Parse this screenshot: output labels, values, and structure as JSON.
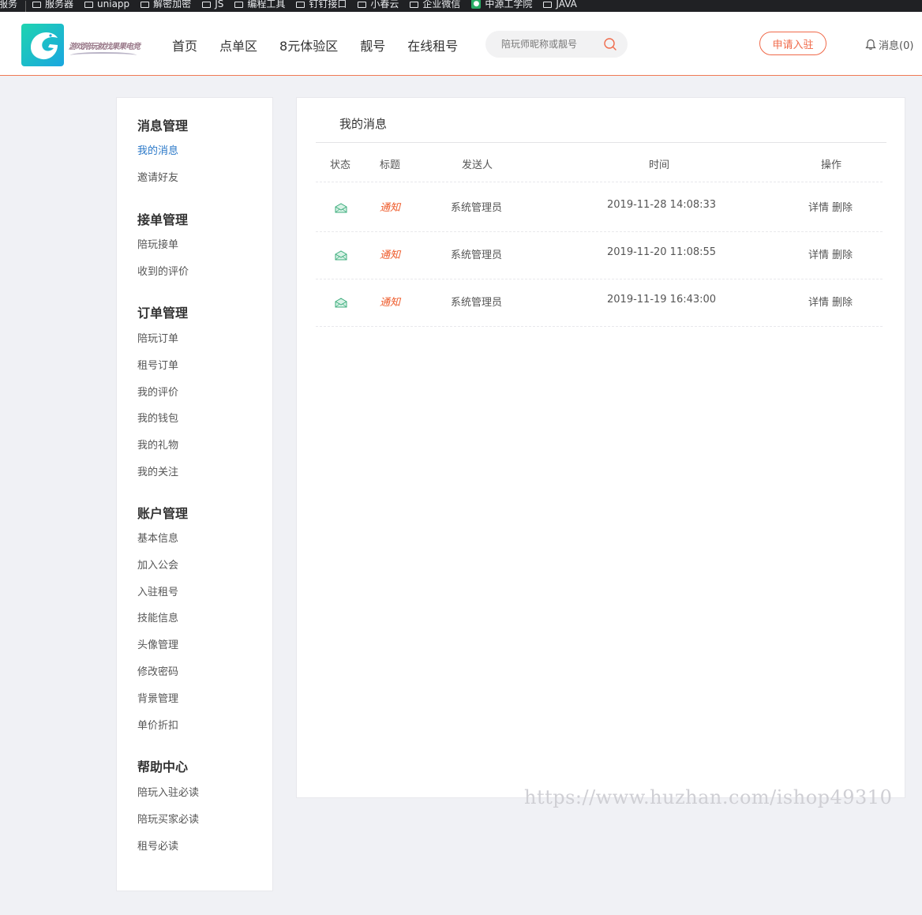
{
  "bookmarks": [
    {
      "label": "服务",
      "icon": "none"
    },
    {
      "label": "服务器",
      "icon": "folder-icon"
    },
    {
      "label": "uniapp",
      "icon": "folder-icon"
    },
    {
      "label": "解密加密",
      "icon": "folder-icon"
    },
    {
      "label": "JS",
      "icon": "folder-icon"
    },
    {
      "label": "编程工具",
      "icon": "folder-icon"
    },
    {
      "label": "钉钉接口",
      "icon": "folder-icon"
    },
    {
      "label": "小春云",
      "icon": "folder-icon"
    },
    {
      "label": "企业微信",
      "icon": "folder-icon"
    },
    {
      "label": "中源工学院",
      "icon": "green-app-icon"
    },
    {
      "label": "JAVA",
      "icon": "folder-icon"
    }
  ],
  "header": {
    "logo_text": "游戏陪玩就找果果电竞",
    "nav": [
      "首页",
      "点单区",
      "8元体验区",
      "靓号",
      "在线租号"
    ],
    "search_placeholder": "陪玩师昵称或靓号",
    "apply_label": "申请入驻",
    "messages_label": "消息(0)",
    "accent_color": "#f06a4a"
  },
  "sidebar": {
    "groups": [
      {
        "title": "消息管理",
        "items": [
          "我的消息",
          "邀请好友"
        ]
      },
      {
        "title": "接单管理",
        "items": [
          "陪玩接单",
          "收到的评价"
        ]
      },
      {
        "title": "订单管理",
        "items": [
          "陪玩订单",
          "租号订单",
          "我的评价",
          "我的钱包",
          "我的礼物",
          "我的关注"
        ]
      },
      {
        "title": "账户管理",
        "items": [
          "基本信息",
          "加入公会",
          "入驻租号",
          "技能信息",
          "头像管理",
          "修改密码",
          "背景管理",
          "单价折扣"
        ]
      },
      {
        "title": "帮助中心",
        "items": [
          "陪玩入驻必读",
          "陪玩买家必读",
          "租号必读"
        ]
      }
    ],
    "active_item": "我的消息",
    "active_color": "#2a78c8"
  },
  "main": {
    "title": "我的消息",
    "columns": [
      "状态",
      "标题",
      "发送人",
      "时间",
      "操作"
    ],
    "rows": [
      {
        "status_icon": "envelope-open-icon",
        "title": "通知",
        "sender": "系统管理员",
        "time": "2019-11-28 14:08:33",
        "actions": [
          "详情",
          "删除"
        ]
      },
      {
        "status_icon": "envelope-open-icon",
        "title": "通知",
        "sender": "系统管理员",
        "time": "2019-11-20 11:08:55",
        "actions": [
          "详情",
          "删除"
        ]
      },
      {
        "status_icon": "envelope-open-icon",
        "title": "通知",
        "sender": "系统管理员",
        "time": "2019-11-19 16:43:00",
        "actions": [
          "详情",
          "删除"
        ]
      }
    ],
    "notice_color": "#ee5a2a"
  },
  "watermark": "https://www.huzhan.com/ishop49310"
}
